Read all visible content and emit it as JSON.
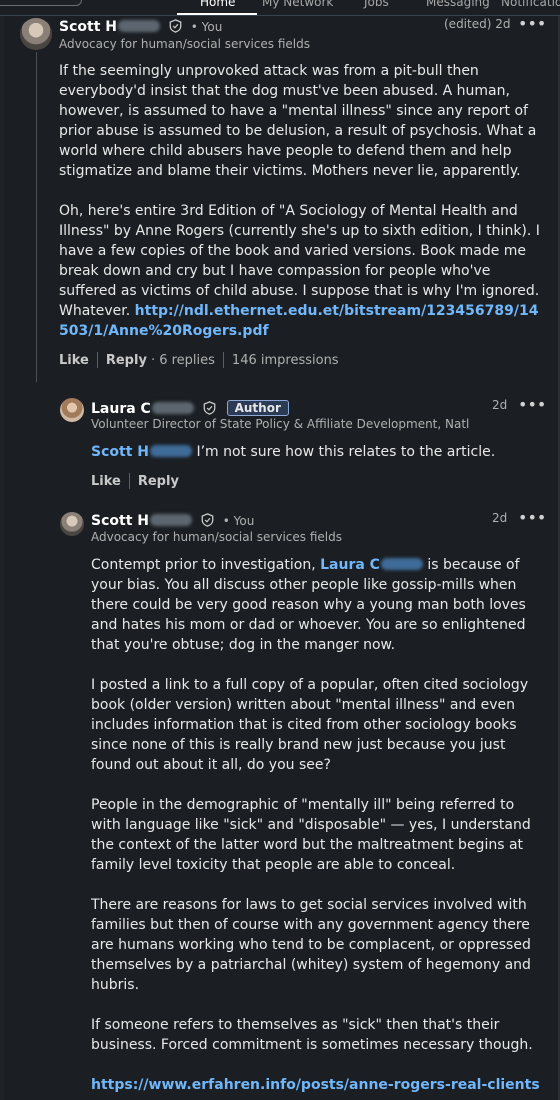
{
  "nav": {
    "tabs": [
      {
        "label": "Home",
        "active": true
      },
      {
        "label": "My Network",
        "active": false
      },
      {
        "label": "Jobs",
        "active": false
      },
      {
        "label": "Messaging",
        "active": false
      },
      {
        "label": "Notifications",
        "active": false
      }
    ]
  },
  "comments": [
    {
      "author": "Scott H",
      "you": "• You",
      "headline": "Advocacy for human/social services fields",
      "time": "(edited) 2d",
      "paragraphs": [
        "If the seemingly unprovoked attack was from a pit-bull then everybody'd insist that the dog must've been abused. A human, however, is assumed to have a \"mental illness\" since any report of prior abuse is assumed to be delusion, a result of psychosis. What a world where child abusers have people to defend them and help stigmatize and blame their victims. Mothers never lie, apparently.",
        "Oh, here's entire 3rd Edition of \"A Sociology of Mental Health and Illness\" by Anne Rogers (currently she's up to sixth edition, I think). I have a few copies of the book and varied versions. Book made me break down and cry but I have compassion for people who've suffered as victims of child abuse. I suppose that is why I'm ignored."
      ],
      "whatever": "Whatever.",
      "link": "http://ndl.ethernet.edu.et/bitstream/123456789/14503/1/Anne%20Rogers.pdf",
      "like": "Like",
      "reply": "Reply",
      "replies": "· 6 replies",
      "impressions": "146 impressions"
    },
    {
      "author": "Laura C",
      "badge": "Author",
      "headline": "Volunteer Director of State Policy & Affiliate Development, Natl Sh...",
      "time": "2d",
      "mention": "Scott H",
      "text": "I’m not sure how this relates to the article.",
      "like": "Like",
      "reply": "Reply"
    },
    {
      "author": "Scott H",
      "you": "• You",
      "headline": "Advocacy for human/social services fields",
      "time": "2d",
      "p1_before": "Contempt prior to investigation, ",
      "mention": "Laura C",
      "p1_after": " is because of your bias. You all discuss other people like gossip-mills when there could be very good reason why a young man both loves and hates his mom or dad or whoever. You are so enlightened that you're obtuse; dog in the manger now.",
      "paragraphs": [
        "I posted a link to a full copy of a popular, often cited sociology book (older version) written about \"mental illness\" and even includes information that is cited from other sociology books since none of this is really brand new just because you just found out about it all, do you see?",
        "People in the demographic of \"mentally ill\" being referred to with language like \"sick\" and \"disposable\" — yes, I understand the context of the latter word but the maltreatment begins at family level toxicity that people are able to conceal.",
        "There are reasons for laws to get social services involved with families but then of course with any government agency there are humans working who tend to be complacent, or oppressed themselves by a patriarchal (whitey) system of hegemony and hubris.",
        "If someone refers to themselves as \"sick\" then that's their business. Forced commitment is sometimes necessary though."
      ],
      "link": "https://www.erfahren.info/posts/anne-rogers-real-clients"
    }
  ]
}
